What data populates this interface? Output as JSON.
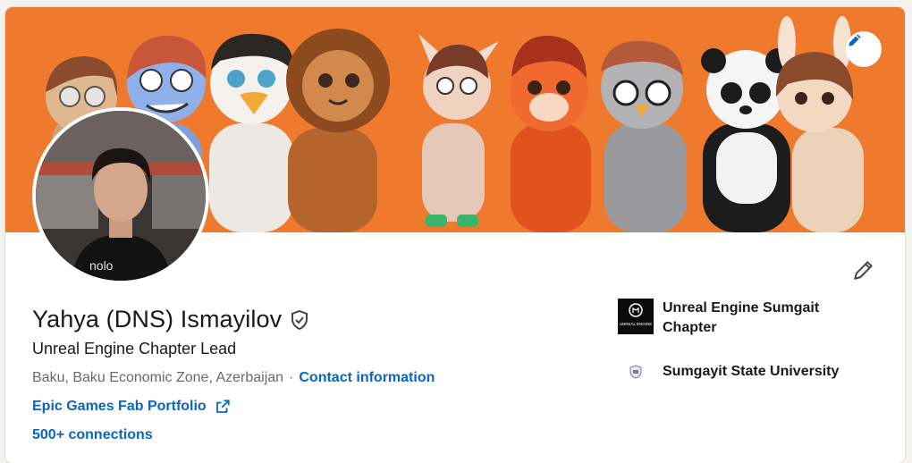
{
  "profile": {
    "name": "Yahya (DNS) Ismayilov",
    "headline": "Unreal Engine Chapter Lead",
    "location": "Baku, Baku Economic Zone, Azerbaijan",
    "separator": "·",
    "contact_link": "Contact information",
    "portfolio_link": "Epic Games Fab Portfolio",
    "connections": "500+ connections"
  },
  "organizations": [
    {
      "name": "Unreal Engine Sumgait Chapter",
      "logo_icon": "unreal-engine-logo",
      "logo_text": "UNREAL ENGINE"
    },
    {
      "name": "Sumgayit State University",
      "logo_icon": "university-crest-logo"
    }
  ],
  "icons": {
    "banner_edit": "pencil-icon",
    "card_edit": "pencil-icon",
    "verified": "verified-shield-icon",
    "external_link": "external-link-icon"
  },
  "colors": {
    "banner": "#ef7a2e",
    "link": "#0a66c2",
    "page_bg": "#f4f2ee"
  }
}
